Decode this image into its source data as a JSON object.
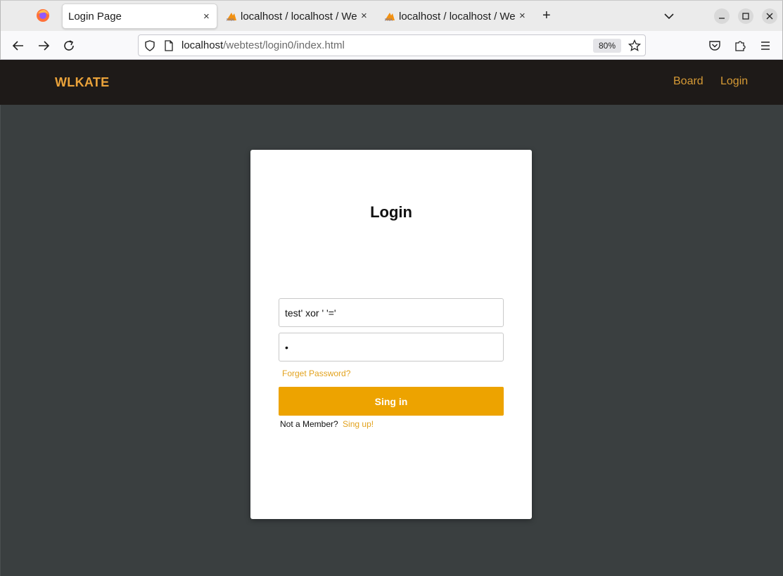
{
  "browser": {
    "tabs": [
      {
        "title": "Login Page",
        "active": true
      },
      {
        "title": "localhost / localhost / We",
        "active": false
      },
      {
        "title": "localhost / localhost / We",
        "active": false
      }
    ],
    "close_glyph": "×",
    "new_tab_glyph": "+",
    "url_host": "localhost",
    "url_path": "/webtest/login0/index.html",
    "zoom": "80%"
  },
  "header": {
    "brand": "WLKATE",
    "links": [
      "Board",
      "Login"
    ],
    "brand_color": "#eba33a",
    "link_color": "#d69a35",
    "background": "#1e1a18"
  },
  "login": {
    "title": "Login",
    "username_value": "test' xor ' '='",
    "password_value": "•",
    "forgot_label": "Forget Password?",
    "signin_label": "Sing in",
    "member_text": "Not a Member?",
    "signup_label": "Sing up!",
    "accent_color": "#eda300"
  }
}
